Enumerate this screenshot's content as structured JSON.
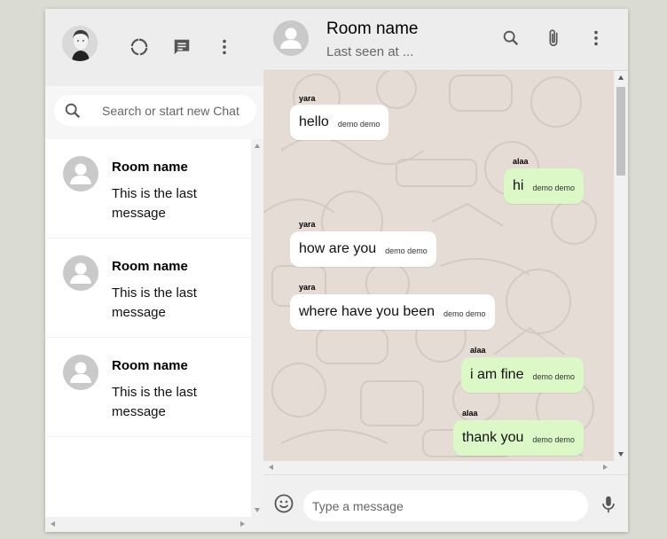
{
  "sidebar": {
    "search": {
      "placeholder": "Search or start new Chat"
    },
    "chats": [
      {
        "name": "Room name",
        "last_message": "This is the last message"
      },
      {
        "name": "Room name",
        "last_message": "This is the last message"
      },
      {
        "name": "Room name",
        "last_message": "This is the last message"
      }
    ],
    "icons": [
      "status-icon",
      "new-chat-icon",
      "more-vert-icon"
    ]
  },
  "chat": {
    "room_name": "Room name",
    "last_seen": "Last seen at ...",
    "icons": [
      "search-icon",
      "attach-icon",
      "more-vert-icon"
    ],
    "messages": [
      {
        "sender": "yara",
        "text": "hello",
        "timestamp": "demo demo",
        "mine": false
      },
      {
        "sender": "alaa",
        "text": "hi",
        "timestamp": "demo demo",
        "mine": true
      },
      {
        "sender": "yara",
        "text": "how are you",
        "timestamp": "demo demo",
        "mine": false
      },
      {
        "sender": "yara",
        "text": "where have you been",
        "timestamp": "demo demo",
        "mine": false
      },
      {
        "sender": "alaa",
        "text": "i am fine",
        "timestamp": "demo demo",
        "mine": true
      },
      {
        "sender": "alaa",
        "text": "thank you",
        "timestamp": "demo demo",
        "mine": true
      }
    ],
    "composer": {
      "placeholder": "Type a message"
    }
  },
  "colors": {
    "page_background": "#dadbd3",
    "header_background": "#ededed",
    "chat_background": "#e5ddd5",
    "sent_bubble": "#dcf8c6",
    "received_bubble": "#ffffff",
    "icon_gray": "#555555"
  }
}
